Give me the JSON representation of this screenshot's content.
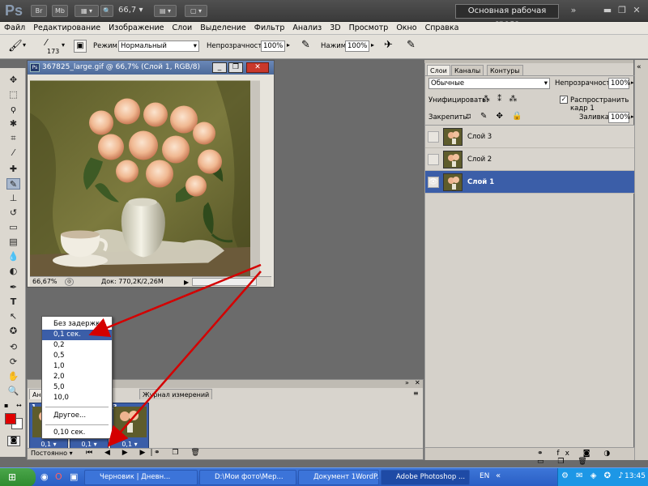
{
  "appbar": {
    "logo": "Ps",
    "br": "Br",
    "mb": "Mb",
    "zoom": "66,7",
    "workspace": "Основная рабочая среда"
  },
  "menu": [
    "Файл",
    "Редактирование",
    "Изображение",
    "Слои",
    "Выделение",
    "Фильтр",
    "Анализ",
    "3D",
    "Просмотр",
    "Окно",
    "Справка"
  ],
  "options": {
    "brush_size": "173",
    "mode_label": "Режим:",
    "mode_value": "Нормальный",
    "opacity_label": "Непрозрачность:",
    "opacity_value": "100%",
    "pressure_label": "Нажим:",
    "pressure_value": "100%"
  },
  "document": {
    "title": "367825_large.gif @ 66,7% (Слой 1, RGB/8)",
    "zoom": "66,67%",
    "doc_info": "Док: 770,2K/2,26M"
  },
  "layers_panel": {
    "tabs": [
      "Слои",
      "Каналы",
      "Контуры"
    ],
    "blend_mode": "Обычные",
    "opacity_label": "Непрозрачность:",
    "opacity_value": "100%",
    "unify_label": "Унифицировать:",
    "propagate_label": "Распространить кадр 1",
    "lock_label": "Закрепить:",
    "fill_label": "Заливка:",
    "fill_value": "100%",
    "layers": [
      {
        "name": "Слой 3",
        "visible": false,
        "selected": false
      },
      {
        "name": "Слой 2",
        "visible": false,
        "selected": false
      },
      {
        "name": "Слой 1",
        "visible": true,
        "selected": true
      }
    ]
  },
  "animation_panel": {
    "tabs": [
      "Ани",
      "Журнал измерений"
    ],
    "loop_value": "Постоянно",
    "frames": [
      {
        "num": "1",
        "delay": "0,1"
      },
      {
        "num": "2",
        "delay": "0,1"
      },
      {
        "num": "3",
        "delay": "0,1"
      }
    ]
  },
  "delay_menu": {
    "items": [
      "Без задержки",
      "0,1 сек.",
      "0,2",
      "0,5",
      "1,0",
      "2,0",
      "5,0",
      "10,0"
    ],
    "selected_index": 1,
    "other": "Другое...",
    "current": "0,10 сек."
  },
  "taskbar": {
    "tasks": [
      "Черновик | Дневн...",
      "D:\\Мои фото\\Мер...",
      "Документ 1WordP...",
      "Adobe Photoshop ..."
    ],
    "active_index": 3,
    "lang": "EN",
    "time": "13:45"
  },
  "colors": {
    "foreground": "#e00000",
    "background": "#ffffff",
    "selection": "#3b5ea8",
    "arrow": "#d40000"
  }
}
